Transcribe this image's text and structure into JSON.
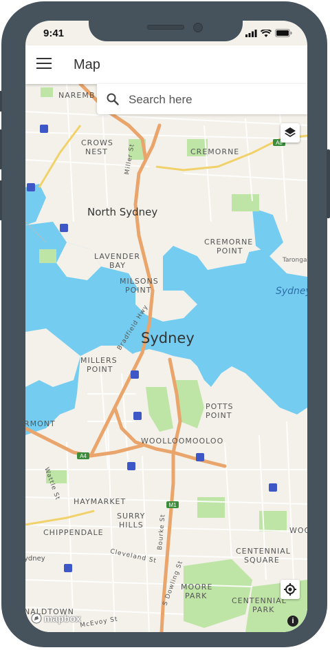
{
  "status_bar": {
    "time": "9:41"
  },
  "app_bar": {
    "title": "Map"
  },
  "search": {
    "placeholder": "Search here"
  },
  "map": {
    "labels": {
      "naremburn": "NAREMB",
      "crows_nest_1": "CROWS",
      "crows_nest_2": "NEST",
      "miller_st": "Miller St",
      "cremorne": "CREMORNE",
      "north_sydney": "North Sydney",
      "cremorne_point_1": "CREMORNE",
      "cremorne_point_2": "POINT",
      "lavender_bay_1": "LAVENDER",
      "lavender_bay_2": "BAY",
      "milsons_point_1": "MILSONS",
      "milsons_point_2": "POINT",
      "taronga": "Taronga",
      "sydney_harbour": "Sydney",
      "bradfield_hwy": "Bradfield Hwy",
      "sydney": "Sydney",
      "millers_point_1": "MILLERS",
      "millers_point_2": "POINT",
      "potts_point_1": "POTTS",
      "potts_point_2": "POINT",
      "pyrmont": "RMONT",
      "woolloomooloo": "WOOLLOOMOOLOO",
      "a4": "A4",
      "a8": "A8",
      "m1": "M1",
      "wattle_st": "Wattle St",
      "haymarket": "HAYMARKET",
      "surry_hills_1": "SURRY",
      "surry_hills_2": "HILLS",
      "bourke_st": "Bourke St",
      "woo": "WOO",
      "chippendale": "CHIPPENDALE",
      "centennial_square_1": "CENTENNIAL",
      "centennial_square_2": "SQUARE",
      "cleveland_st": "Cleveland St",
      "s_dowling_st": "S Dowling St",
      "sydney_uni": "ydney",
      "moore_park_1": "MOORE",
      "moore_park_2": "PARK",
      "centennial_park_1": "CENTENNIAL",
      "centennial_park_2": "PARK",
      "newtown": "NALDTOWN",
      "mcevoy_st": "McEvoy St"
    }
  },
  "attribution": {
    "logo": "mapbox",
    "info": "i"
  },
  "colors": {
    "water": "#74cdf0",
    "land": "#f4f1ea",
    "park": "#bfe5a6",
    "road_major": "#e9a56b",
    "road_yellow": "#f1d26a",
    "frame": "#46535d"
  }
}
